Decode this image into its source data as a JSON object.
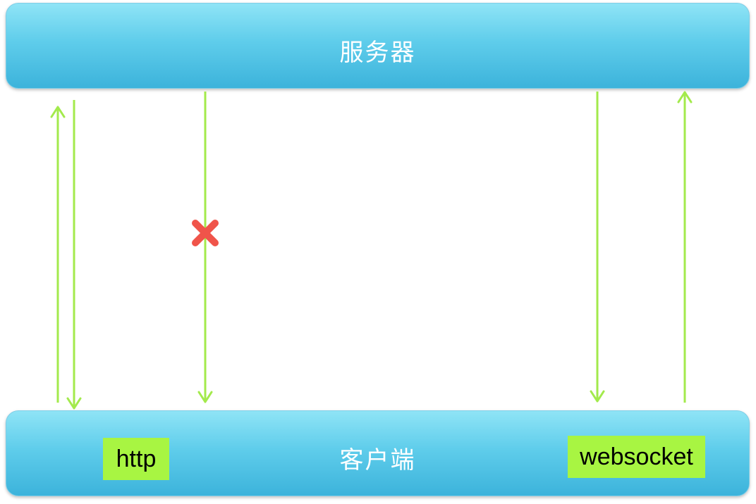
{
  "server": {
    "label": "服务器"
  },
  "client": {
    "label": "客户端",
    "tags": {
      "http": "http",
      "websocket": "websocket"
    }
  },
  "colors": {
    "bar_top": "#8fe4f6",
    "bar_bottom": "#3cb3db",
    "arrow": "#a3ea4c",
    "tag": "#a8f542",
    "blocked": "#f0544a"
  }
}
